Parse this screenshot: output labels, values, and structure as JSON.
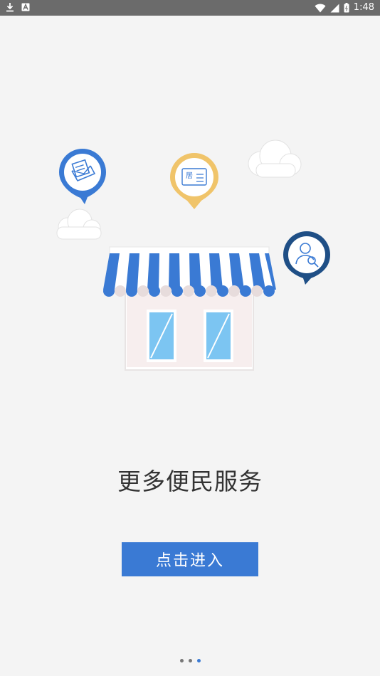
{
  "status_bar": {
    "time": "1:48",
    "left_icons": [
      "download-icon",
      "a-notification-icon"
    ],
    "right_icons": [
      "wifi-icon",
      "signal-icon",
      "battery-icon"
    ]
  },
  "illustration": {
    "pin_labels": [
      "居"
    ],
    "colors": {
      "awning_blue": "#3a7ad4",
      "pin_yellow": "#f0c46a",
      "pin_navy": "#1f4f86",
      "window_blue": "#7cc5f2"
    }
  },
  "main": {
    "title": "更多便民服务",
    "enter_label": "点击进入"
  },
  "pager": {
    "count": 3,
    "active_index": 2,
    "active_color": "#3a7ad4",
    "inactive_color": "#777777"
  }
}
